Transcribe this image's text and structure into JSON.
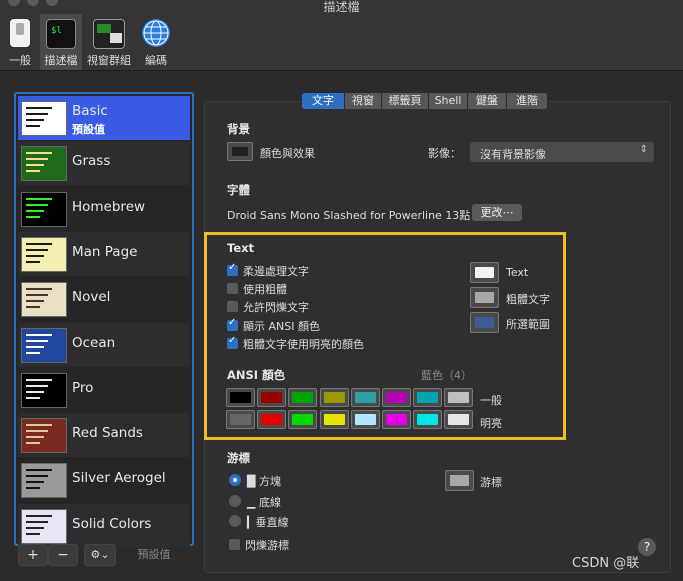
{
  "window": {
    "title": "描述檔"
  },
  "toolbar": {
    "items": [
      {
        "label": "一般",
        "icon": "switch-icon"
      },
      {
        "label": "描述檔",
        "icon": "terminal-icon"
      },
      {
        "label": "視窗群組",
        "icon": "windows-icon"
      },
      {
        "label": "編碼",
        "icon": "globe-icon"
      }
    ]
  },
  "profiles": [
    {
      "name": "Basic",
      "sub": "預設值",
      "thumb_bg": "#ffffff",
      "thumb_fg": "#1a1a1a"
    },
    {
      "name": "Grass",
      "thumb_bg": "#1d6a1d",
      "thumb_fg": "#f6e08b"
    },
    {
      "name": "Homebrew",
      "thumb_bg": "#000000",
      "thumb_fg": "#2ef02e"
    },
    {
      "name": "Man Page",
      "thumb_bg": "#f3efb0",
      "thumb_fg": "#1a1a1a"
    },
    {
      "name": "Novel",
      "thumb_bg": "#e9e1c6",
      "thumb_fg": "#4a3322"
    },
    {
      "name": "Ocean",
      "thumb_bg": "#22479f",
      "thumb_fg": "#ffffff"
    },
    {
      "name": "Pro",
      "thumb_bg": "#000000",
      "thumb_fg": "#e6e6e6"
    },
    {
      "name": "Red Sands",
      "thumb_bg": "#7a2b1f",
      "thumb_fg": "#ddc79d"
    },
    {
      "name": "Silver Aerogel",
      "thumb_bg": "#9a9a9a",
      "thumb_fg": "#111111"
    },
    {
      "name": "Solid Colors",
      "thumb_bg": "#e6e6f5",
      "thumb_fg": "#222222"
    }
  ],
  "sidebar_bar": {
    "add": "+",
    "remove": "−",
    "gear": "⚙︎⌄",
    "default": "預設值"
  },
  "tabs": [
    "文字",
    "視窗",
    "標籤頁",
    "Shell",
    "鍵盤",
    "進階"
  ],
  "background": {
    "heading": "背景",
    "swatch_label": "顏色與效果",
    "swatch_color": "#202020",
    "image_label": "影像：",
    "image_value": "沒有背景影像"
  },
  "font": {
    "heading": "字體",
    "value": "Droid Sans Mono Slashed for Powerline 13點",
    "change_button": "更改⋯"
  },
  "text": {
    "heading": "Text",
    "options": [
      {
        "label": "柔邊處理文字",
        "checked": true
      },
      {
        "label": "使用粗體",
        "checked": false
      },
      {
        "label": "允許閃爍文字",
        "checked": false
      },
      {
        "label": "顯示 ANSI 顏色",
        "checked": true
      },
      {
        "label": "粗體文字使用明亮的顏色",
        "checked": true
      }
    ],
    "swatches": [
      {
        "label": "Text",
        "color": "#f2f2f2"
      },
      {
        "label": "粗體文字",
        "color": "#a8a8a8"
      },
      {
        "label": "所選範圍",
        "color": "#3f5c9a"
      }
    ]
  },
  "ansi": {
    "heading": "ANSI 顏色",
    "hint": "藍色（4）",
    "normal_label": "一般",
    "bright_label": "明亮",
    "normal": [
      "#000000",
      "#990000",
      "#00a600",
      "#999900",
      "#2d9fa5",
      "#b200b2",
      "#00a6b2",
      "#bfbfbf"
    ],
    "bright": [
      "#666666",
      "#e50000",
      "#00d900",
      "#e5e500",
      "#b3e6ff",
      "#e500e5",
      "#00e5e5",
      "#e5e5e5"
    ]
  },
  "cursor": {
    "heading": "游標",
    "options": [
      {
        "label": "█ 方塊",
        "selected": true
      },
      {
        "label": "▁ 底線",
        "selected": false
      },
      {
        "label": "▎垂直線",
        "selected": false
      }
    ],
    "blink_label": "閃爍游標",
    "swatch_label": "游標",
    "swatch_color": "#a8a8a8"
  },
  "help": "?",
  "watermark": "CSDN @联"
}
